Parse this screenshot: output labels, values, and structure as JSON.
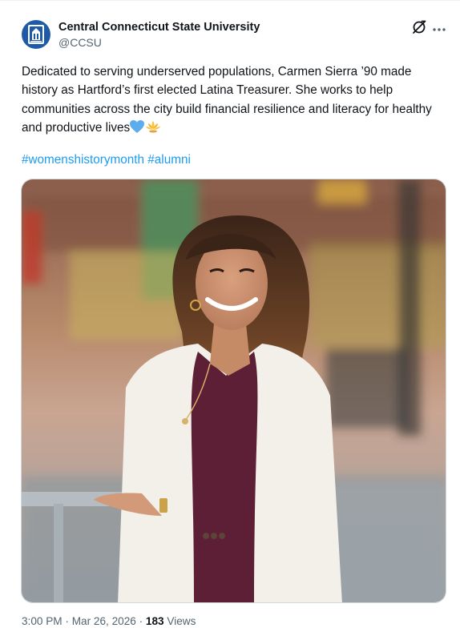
{
  "account": {
    "name": "Central Connecticut State University",
    "handle": "@CCSU",
    "avatar_color": "#1f5aa8"
  },
  "post": {
    "text": "Dedicated to serving underserved populations, Carmen Sierra ’90 made history as Hartford’s first elected Latina Treasurer. She works to help communities across the city build financial resilience and literacy for healthy and productive lives",
    "emojis": [
      "blue-heart-icon",
      "lotus-icon"
    ],
    "hashtags": [
      "#womenshistorymonth",
      "#alumni"
    ],
    "image_alt": "photo",
    "time": "3:00 PM",
    "date": "Mar 26, 2026",
    "separator": "·",
    "views_count": "183",
    "views_label": "Views"
  },
  "icons": {
    "grok": "grok-icon",
    "more": "more-icon"
  },
  "colors": {
    "link": "#1d9bf0",
    "secondary_text": "#536471",
    "primary_text": "#0f1419"
  }
}
